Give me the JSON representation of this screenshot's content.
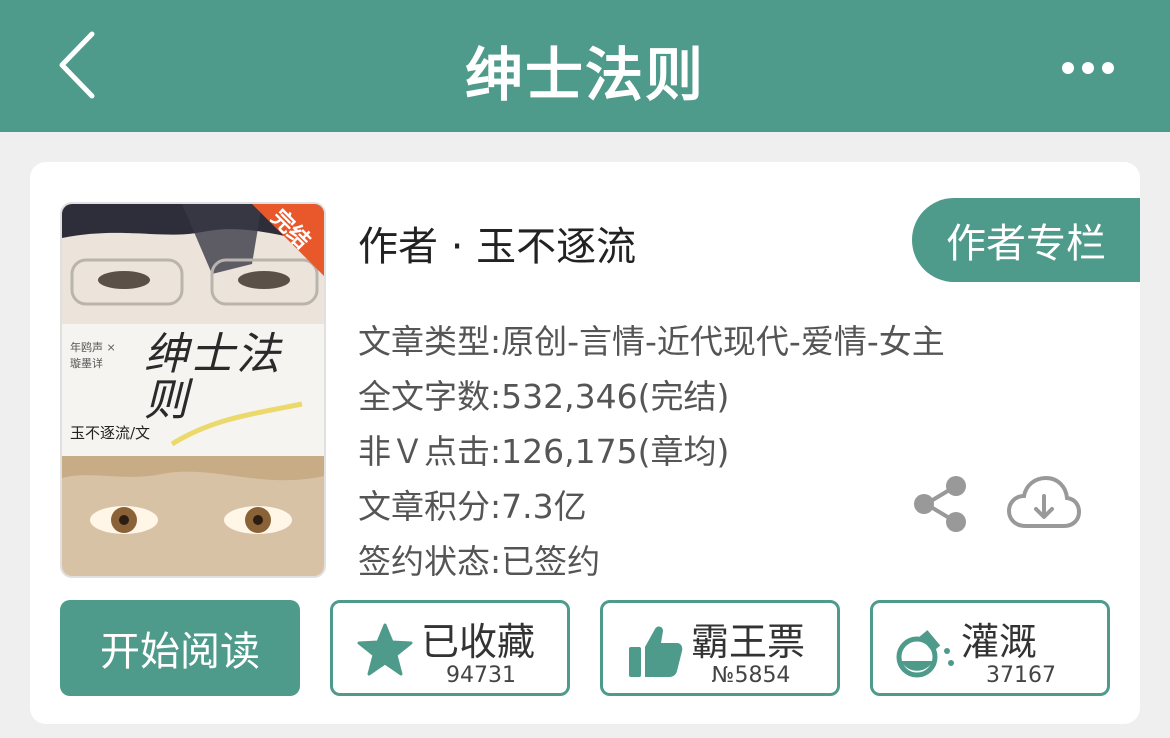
{
  "header": {
    "title": "绅士法则",
    "back_icon": "chevron-left-icon",
    "more_icon": "more-horizontal-icon"
  },
  "cover": {
    "badge": "完结",
    "calligraphy": "绅士法则",
    "credits": "年鸥声 × 璇墨详",
    "author_line": "玉不逐流/文"
  },
  "book": {
    "author": "作者 · 玉不逐流",
    "author_column_label": "作者专栏",
    "info": [
      "文章类型:原创-言情-近代现代-爱情-女主",
      "全文字数:532,346(完结)",
      "非Ｖ点击:126,175(章均)",
      "文章积分:7.3亿",
      "签约状态:已签约"
    ]
  },
  "actions": {
    "read_label": "开始阅读",
    "favorite": {
      "label": "已收藏",
      "count": "94731",
      "icon": "star-icon"
    },
    "vote": {
      "label": "霸王票",
      "count": "№5854",
      "icon": "thumbs-up-icon"
    },
    "nutrient": {
      "label": "灌溉",
      "count": "37167",
      "icon": "flask-icon"
    }
  },
  "colors": {
    "accent": "#4e9a8b",
    "badge": "#e8582a"
  }
}
